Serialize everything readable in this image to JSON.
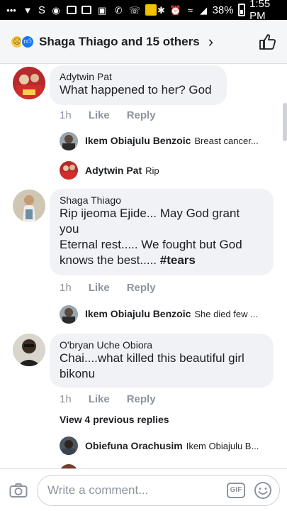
{
  "status_bar": {
    "battery": "38%",
    "time": "1:55 PM",
    "carrier_letter": "S"
  },
  "header": {
    "title": "Shaga Thiago and 15 others",
    "reactions": [
      "sad-reaction-icon",
      "like-reaction-icon"
    ]
  },
  "comments": [
    {
      "name": "Adytwin Pat",
      "text": "What happened to her? God",
      "time": "1h",
      "like": "Like",
      "reply": "Reply",
      "replies": [
        {
          "name": "Ikem Obiajulu Benzoic",
          "text": "Breast cancer..."
        },
        {
          "name": "Adytwin Pat",
          "text": "Rip"
        }
      ]
    },
    {
      "name": "Shaga Thiago",
      "text_lines": [
        "Rip ijeoma Ejide... May God grant",
        "you",
        "Eternal rest..... We fought but God",
        "knows the best..... "
      ],
      "hashtag": "#tears",
      "time": "1h",
      "like": "Like",
      "reply": "Reply",
      "replies": [
        {
          "name": "Ikem Obiajulu Benzoic",
          "text": "She died few ..."
        }
      ]
    },
    {
      "name": "O'bryan Uche Obiora",
      "text_lines": [
        "Chai....what killed this beautiful girl",
        "bikonu"
      ],
      "time": "1h",
      "like": "Like",
      "reply": "Reply",
      "view_previous": "View 4 previous replies",
      "replies": [
        {
          "name": "Obiefuna Orachusim",
          "text": "Ikem Obiajulu B..."
        }
      ]
    }
  ],
  "composer": {
    "placeholder": "Write a comment...",
    "gif_label": "GIF"
  },
  "colors": {
    "bubble": "#f0f2f5",
    "meta_text": "#8d949e",
    "like_blue": "#1877f2"
  }
}
